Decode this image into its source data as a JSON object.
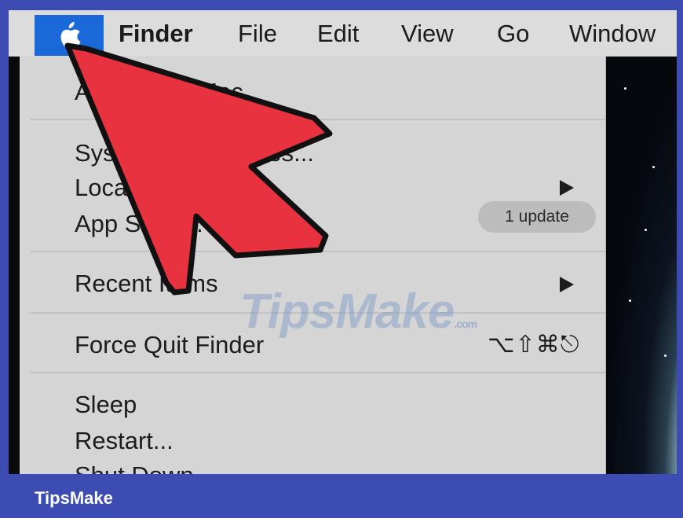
{
  "menubar": {
    "app": "Finder",
    "menus": [
      "File",
      "Edit",
      "View",
      "Go",
      "Window"
    ]
  },
  "apple_menu": {
    "about": "About This Mac",
    "system_prefs": "System Preferences...",
    "location": "Location",
    "app_store": "App Store...",
    "app_store_badge": "1 update",
    "recent_items": "Recent Items",
    "force_quit": "Force Quit Finder",
    "force_quit_shortcut": "⌥⇧⌘⎋",
    "sleep": "Sleep",
    "restart": "Restart...",
    "shut_down": "Shut Down..."
  },
  "watermark": {
    "text": "TipsMake",
    "suffix": ".com"
  },
  "footer": {
    "brand": "TipsMake"
  },
  "colors": {
    "frame": "#3d4cb3",
    "apple_highlight": "#1b68d8",
    "pointer": "#e8323f"
  },
  "icons": {
    "apple": "apple-logo-icon",
    "submenu": "triangle-right-icon"
  }
}
